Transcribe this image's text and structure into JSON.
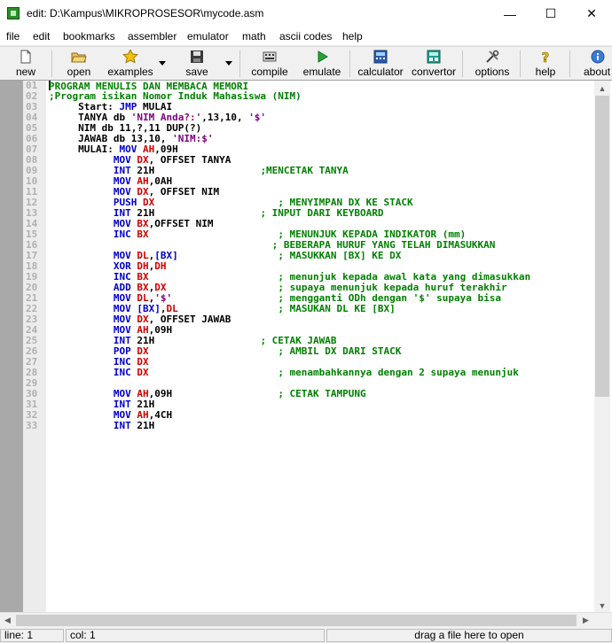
{
  "window": {
    "title": "edit: D:\\Kampus\\MIKROPROSESOR\\mycode.asm",
    "minimize_glyph": "—",
    "maximize_glyph": "☐",
    "close_glyph": "✕"
  },
  "menu": [
    "file",
    "edit",
    "bookmarks",
    "assembler",
    "emulator",
    "math",
    "ascii codes",
    "help"
  ],
  "toolbar": {
    "new": "new",
    "open": "open",
    "examples": "examples",
    "save": "save",
    "compile": "compile",
    "emulate": "emulate",
    "calculator": "calculator",
    "convertor": "convertor",
    "options": "options",
    "help": "help",
    "about": "about"
  },
  "gutter": [
    "01",
    "02",
    "03",
    "04",
    "05",
    "06",
    "07",
    "08",
    "09",
    "10",
    "11",
    "12",
    "13",
    "14",
    "15",
    "16",
    "17",
    "18",
    "19",
    "20",
    "21",
    "22",
    "23",
    "24",
    "25",
    "26",
    "27",
    "28",
    "29",
    "30",
    "31",
    "32",
    "33"
  ],
  "code": [
    {
      "segs": [
        {
          "t": "PROGRAM MENULIS DAN MEMBACA MEMORI",
          "c": "c"
        }
      ],
      "caret": true
    },
    {
      "segs": [
        {
          "t": ";Program isikan Nomor Induk Mahasiswa (NIM)",
          "c": "c"
        }
      ]
    },
    {
      "segs": [
        {
          "t": "     Start: ",
          "c": ""
        },
        {
          "t": "JMP",
          "c": "k"
        },
        {
          "t": " MULAI",
          "c": ""
        }
      ]
    },
    {
      "segs": [
        {
          "t": "     TANYA db ",
          "c": ""
        },
        {
          "t": "'NIM Anda?:'",
          "c": "s"
        },
        {
          "t": ",13,10, ",
          "c": ""
        },
        {
          "t": "'$'",
          "c": "s"
        }
      ]
    },
    {
      "segs": [
        {
          "t": "     NIM db 11,?,11 DUP(?)",
          "c": ""
        }
      ]
    },
    {
      "segs": [
        {
          "t": "     JAWAB db 13,10, ",
          "c": ""
        },
        {
          "t": "'NIM:$'",
          "c": "s"
        }
      ]
    },
    {
      "segs": [
        {
          "t": "     MULAI: ",
          "c": ""
        },
        {
          "t": "MOV",
          "c": "k"
        },
        {
          "t": " ",
          "c": ""
        },
        {
          "t": "AH",
          "c": "r"
        },
        {
          "t": ",09H",
          "c": ""
        }
      ]
    },
    {
      "segs": [
        {
          "t": "           ",
          "c": ""
        },
        {
          "t": "MOV",
          "c": "k"
        },
        {
          "t": " ",
          "c": ""
        },
        {
          "t": "DX",
          "c": "r"
        },
        {
          "t": ", OFFSET TANYA",
          "c": ""
        }
      ]
    },
    {
      "segs": [
        {
          "t": "           ",
          "c": ""
        },
        {
          "t": "INT",
          "c": "k"
        },
        {
          "t": " 21H                  ",
          "c": ""
        },
        {
          "t": ";MENCETAK TANYA",
          "c": "c"
        }
      ]
    },
    {
      "segs": [
        {
          "t": "           ",
          "c": ""
        },
        {
          "t": "MOV",
          "c": "k"
        },
        {
          "t": " ",
          "c": ""
        },
        {
          "t": "AH",
          "c": "r"
        },
        {
          "t": ",0AH",
          "c": ""
        }
      ]
    },
    {
      "segs": [
        {
          "t": "           ",
          "c": ""
        },
        {
          "t": "MOV",
          "c": "k"
        },
        {
          "t": " ",
          "c": ""
        },
        {
          "t": "DX",
          "c": "r"
        },
        {
          "t": ", OFFSET NIM",
          "c": ""
        }
      ]
    },
    {
      "segs": [
        {
          "t": "           ",
          "c": ""
        },
        {
          "t": "PUSH",
          "c": "k"
        },
        {
          "t": " ",
          "c": ""
        },
        {
          "t": "DX",
          "c": "r"
        },
        {
          "t": "                     ",
          "c": ""
        },
        {
          "t": "; MENYIMPAN DX KE STACK",
          "c": "c"
        }
      ]
    },
    {
      "segs": [
        {
          "t": "           ",
          "c": ""
        },
        {
          "t": "INT",
          "c": "k"
        },
        {
          "t": " 21H                  ",
          "c": ""
        },
        {
          "t": "; INPUT DARI KEYBOARD",
          "c": "c"
        }
      ]
    },
    {
      "segs": [
        {
          "t": "           ",
          "c": ""
        },
        {
          "t": "MOV",
          "c": "k"
        },
        {
          "t": " ",
          "c": ""
        },
        {
          "t": "BX",
          "c": "r"
        },
        {
          "t": ",OFFSET NIM",
          "c": ""
        }
      ]
    },
    {
      "segs": [
        {
          "t": "           ",
          "c": ""
        },
        {
          "t": "INC",
          "c": "k"
        },
        {
          "t": " ",
          "c": ""
        },
        {
          "t": "BX",
          "c": "r"
        },
        {
          "t": "                      ",
          "c": ""
        },
        {
          "t": "; MENUNJUK KEPADA INDIKATOR (mm)",
          "c": "c"
        }
      ]
    },
    {
      "segs": [
        {
          "t": "                                      ",
          "c": ""
        },
        {
          "t": "; BEBERAPA HURUF YANG TELAH DIMASUKKAN",
          "c": "c"
        }
      ]
    },
    {
      "segs": [
        {
          "t": "           ",
          "c": ""
        },
        {
          "t": "MOV",
          "c": "k"
        },
        {
          "t": " ",
          "c": ""
        },
        {
          "t": "DL",
          "c": "r"
        },
        {
          "t": ",",
          "c": ""
        },
        {
          "t": "[BX]",
          "c": "k"
        },
        {
          "t": "                 ",
          "c": ""
        },
        {
          "t": "; MASUKKAN [BX] KE DX",
          "c": "c"
        }
      ]
    },
    {
      "segs": [
        {
          "t": "           ",
          "c": ""
        },
        {
          "t": "XOR",
          "c": "k"
        },
        {
          "t": " ",
          "c": ""
        },
        {
          "t": "DH",
          "c": "r"
        },
        {
          "t": ",",
          "c": ""
        },
        {
          "t": "DH",
          "c": "r"
        }
      ]
    },
    {
      "segs": [
        {
          "t": "           ",
          "c": ""
        },
        {
          "t": "INC",
          "c": "k"
        },
        {
          "t": " ",
          "c": ""
        },
        {
          "t": "BX",
          "c": "r"
        },
        {
          "t": "                      ",
          "c": ""
        },
        {
          "t": "; menunjuk kepada awal kata yang dimasukkan",
          "c": "c"
        }
      ]
    },
    {
      "segs": [
        {
          "t": "           ",
          "c": ""
        },
        {
          "t": "ADD",
          "c": "k"
        },
        {
          "t": " ",
          "c": ""
        },
        {
          "t": "BX",
          "c": "r"
        },
        {
          "t": ",",
          "c": ""
        },
        {
          "t": "DX",
          "c": "r"
        },
        {
          "t": "                   ",
          "c": ""
        },
        {
          "t": "; supaya menunjuk kepada huruf terakhir",
          "c": "c"
        }
      ]
    },
    {
      "segs": [
        {
          "t": "           ",
          "c": ""
        },
        {
          "t": "MOV",
          "c": "k"
        },
        {
          "t": " ",
          "c": ""
        },
        {
          "t": "DL",
          "c": "r"
        },
        {
          "t": ",",
          "c": ""
        },
        {
          "t": "'$'",
          "c": "s"
        },
        {
          "t": "                  ",
          "c": ""
        },
        {
          "t": "; mengganti ODh dengan '$' supaya bisa",
          "c": "c"
        }
      ]
    },
    {
      "segs": [
        {
          "t": "           ",
          "c": ""
        },
        {
          "t": "MOV",
          "c": "k"
        },
        {
          "t": " ",
          "c": ""
        },
        {
          "t": "[BX]",
          "c": "k"
        },
        {
          "t": ",",
          "c": ""
        },
        {
          "t": "DL",
          "c": "r"
        },
        {
          "t": "                 ",
          "c": ""
        },
        {
          "t": "; MASUKAN DL KE [BX]",
          "c": "c"
        }
      ]
    },
    {
      "segs": [
        {
          "t": "           ",
          "c": ""
        },
        {
          "t": "MOV",
          "c": "k"
        },
        {
          "t": " ",
          "c": ""
        },
        {
          "t": "DX",
          "c": "r"
        },
        {
          "t": ", OFFSET JAWAB",
          "c": ""
        }
      ]
    },
    {
      "segs": [
        {
          "t": "           ",
          "c": ""
        },
        {
          "t": "MOV",
          "c": "k"
        },
        {
          "t": " ",
          "c": ""
        },
        {
          "t": "AH",
          "c": "r"
        },
        {
          "t": ",09H",
          "c": ""
        }
      ]
    },
    {
      "segs": [
        {
          "t": "           ",
          "c": ""
        },
        {
          "t": "INT",
          "c": "k"
        },
        {
          "t": " 21H                  ",
          "c": ""
        },
        {
          "t": "; CETAK JAWAB",
          "c": "c"
        }
      ]
    },
    {
      "segs": [
        {
          "t": "           ",
          "c": ""
        },
        {
          "t": "POP",
          "c": "k"
        },
        {
          "t": " ",
          "c": ""
        },
        {
          "t": "DX",
          "c": "r"
        },
        {
          "t": "                      ",
          "c": ""
        },
        {
          "t": "; AMBIL DX DARI STACK",
          "c": "c"
        }
      ]
    },
    {
      "segs": [
        {
          "t": "           ",
          "c": ""
        },
        {
          "t": "INC",
          "c": "k"
        },
        {
          "t": " ",
          "c": ""
        },
        {
          "t": "DX",
          "c": "r"
        }
      ]
    },
    {
      "segs": [
        {
          "t": "           ",
          "c": ""
        },
        {
          "t": "INC",
          "c": "k"
        },
        {
          "t": " ",
          "c": ""
        },
        {
          "t": "DX",
          "c": "r"
        },
        {
          "t": "                      ",
          "c": ""
        },
        {
          "t": "; menambahkannya dengan 2 supaya menunjuk",
          "c": "c"
        }
      ]
    },
    {
      "segs": [
        {
          "t": "",
          "c": ""
        }
      ]
    },
    {
      "segs": [
        {
          "t": "           ",
          "c": ""
        },
        {
          "t": "MOV",
          "c": "k"
        },
        {
          "t": " ",
          "c": ""
        },
        {
          "t": "AH",
          "c": "r"
        },
        {
          "t": ",09H                  ",
          "c": ""
        },
        {
          "t": "; CETAK TAMPUNG",
          "c": "c"
        }
      ]
    },
    {
      "segs": [
        {
          "t": "           ",
          "c": ""
        },
        {
          "t": "INT",
          "c": "k"
        },
        {
          "t": " 21H",
          "c": ""
        }
      ]
    },
    {
      "segs": [
        {
          "t": "           ",
          "c": ""
        },
        {
          "t": "MOV",
          "c": "k"
        },
        {
          "t": " ",
          "c": ""
        },
        {
          "t": "AH",
          "c": "r"
        },
        {
          "t": ",4CH",
          "c": ""
        }
      ]
    },
    {
      "segs": [
        {
          "t": "           ",
          "c": ""
        },
        {
          "t": "INT",
          "c": "k"
        },
        {
          "t": " 21H",
          "c": ""
        }
      ]
    }
  ],
  "status": {
    "line": "line: 1",
    "col": "col: 1",
    "hint": "drag a file here to open"
  },
  "colors": {
    "keyword": "#0000cc",
    "register": "#cc0000",
    "comment": "#008000",
    "string": "#800080"
  }
}
